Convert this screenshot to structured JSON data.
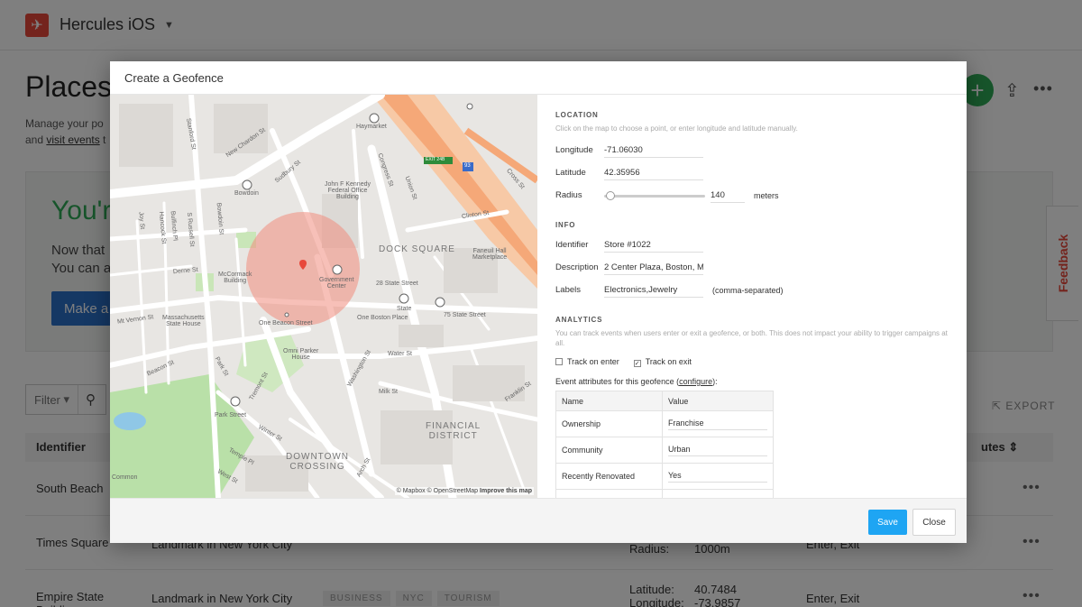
{
  "app": {
    "name": "Hercules iOS",
    "logo_icon": "plane-icon",
    "brand_color": "#e8483b"
  },
  "page": {
    "title": "Places",
    "subtitle_line1": "Manage your po",
    "subtitle_line2_prefix": "and ",
    "subtitle_link": "visit events",
    "subtitle_line2_suffix": " t"
  },
  "promo": {
    "heading": "You'r",
    "line1": "Now that",
    "line2": "You can a",
    "button": "Make a"
  },
  "feedback": {
    "label": "Feedback"
  },
  "list_controls": {
    "filter_label": "Filter",
    "export_label": "EXPORT"
  },
  "table": {
    "col_identifier": "Identifier",
    "col_attributes": "utes",
    "rows": [
      {
        "name": "South Beach"
      },
      {
        "name": "Times Square",
        "description": "Landmark in New York City",
        "coords_labels": "Longitude:\nRadius:",
        "coords_values": "-73.9855\n1000m",
        "events": "Enter, Exit"
      },
      {
        "name": "Empire State Building",
        "description": "Landmark in New York City",
        "tags": [
          "BUSINESS",
          "NYC",
          "TOURISM"
        ],
        "coords_labels": "Latitude:\nLongitude:",
        "coords_values": "40.7484\n-73.9857",
        "events": "Enter, Exit"
      }
    ]
  },
  "modal": {
    "title": "Create a Geofence",
    "location": {
      "section": "LOCATION",
      "hint": "Click on the map to choose a point, or enter longitude and latitude manually.",
      "longitude_label": "Longitude",
      "longitude": "-71.06030",
      "latitude_label": "Latitude",
      "latitude": "42.35956",
      "radius_label": "Radius",
      "radius": "140",
      "radius_unit": "meters",
      "radius_slider_fraction": 0.02
    },
    "info": {
      "section": "INFO",
      "identifier_label": "Identifier",
      "identifier": "Store #1022",
      "description_label": "Description",
      "description": "2 Center Plaza, Boston, M",
      "labels_label": "Labels",
      "labels": "Electronics,Jewelry",
      "labels_note": "(comma-separated)"
    },
    "analytics": {
      "section": "ANALYTICS",
      "hint": "You can track events when users enter or exit a geofence, or both. This does not impact your ability to trigger campaigns at all.",
      "track_enter_label": "Track on enter",
      "track_enter_checked": false,
      "track_exit_label": "Track on exit",
      "track_exit_checked": true,
      "attributes_prefix": "Event attributes for this geofence (",
      "attributes_link": "configure",
      "attributes_suffix": "):",
      "col_name": "Name",
      "col_value": "Value",
      "attributes": [
        {
          "name": "Ownership",
          "value": "Franchise"
        },
        {
          "name": "Community",
          "value": "Urban"
        },
        {
          "name": "Recently Renovated",
          "value": "Yes"
        }
      ]
    },
    "map": {
      "attribution_prefix": "© Mapbox © OpenStreetMap ",
      "attribution_link": "Improve this map",
      "labels": {
        "haymarket": "Haymarket",
        "new_chardon": "New Chardon St",
        "sudbury": "Sudbury St",
        "jfk": "John F Kennedy\nFederal Office\nBuilding",
        "congress": "Congress St",
        "bowdoin": "Bowdoin",
        "union": "Union St",
        "cross": "Cross St",
        "clinton": "Clinton St",
        "dock_square": "DOCK SQUARE",
        "faneuil": "Faneuil Hall\nMarketplace",
        "government_center": "Government\nCenter",
        "state_street_28": "28 State Street",
        "mccormack": "McCormack\nBuilding",
        "derne": "Derne St",
        "one_beacon": "One Beacon Street",
        "one_boston": "One Boston Place",
        "state": "State",
        "state_75": "75 State Street",
        "mass_state_house": "Massachusetts\nState House",
        "mt_vernon": "Mt Vernon St",
        "omni": "Omni Parker\nHouse",
        "water": "Water St",
        "beacon": "Beacon St",
        "park": "Park St",
        "washington": "Washington St",
        "milk": "Milk St",
        "tremont": "Tremont St",
        "financial": "FINANCIAL\nDISTRICT",
        "park_street": "Park Street",
        "winter": "Winter St",
        "temple": "Temple Pl",
        "downtown": "DOWNTOWN\nCROSSING",
        "arch": "Arch St",
        "franklin": "Franklin St",
        "west": "West St",
        "common": "Common",
        "stanford": "Stanford St",
        "bowdoin_st": "Bowdoin St",
        "joy": "Joy St",
        "hancock": "Hancock St",
        "bulfinch": "Bulfinch Pl",
        "russell": "S Russell St",
        "exit_sign": "EXIT 24B",
        "hwy": "93"
      }
    },
    "footer": {
      "save": "Save",
      "close": "Close"
    }
  }
}
